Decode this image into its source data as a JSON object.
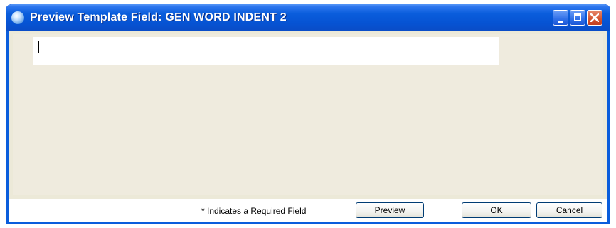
{
  "window": {
    "title": "Preview Template Field: GEN WORD INDENT 2",
    "controls": {
      "minimize_icon": "minimize-icon",
      "maximize_icon": "maximize-icon",
      "close_icon": "close-icon"
    },
    "accent": "#0a5ddc",
    "close_color": "#d4532e"
  },
  "field": {
    "value": "",
    "placeholder": ""
  },
  "footer": {
    "required_note": "* Indicates a Required Field",
    "preview_label": "Preview",
    "ok_label": "OK",
    "cancel_label": "Cancel"
  }
}
